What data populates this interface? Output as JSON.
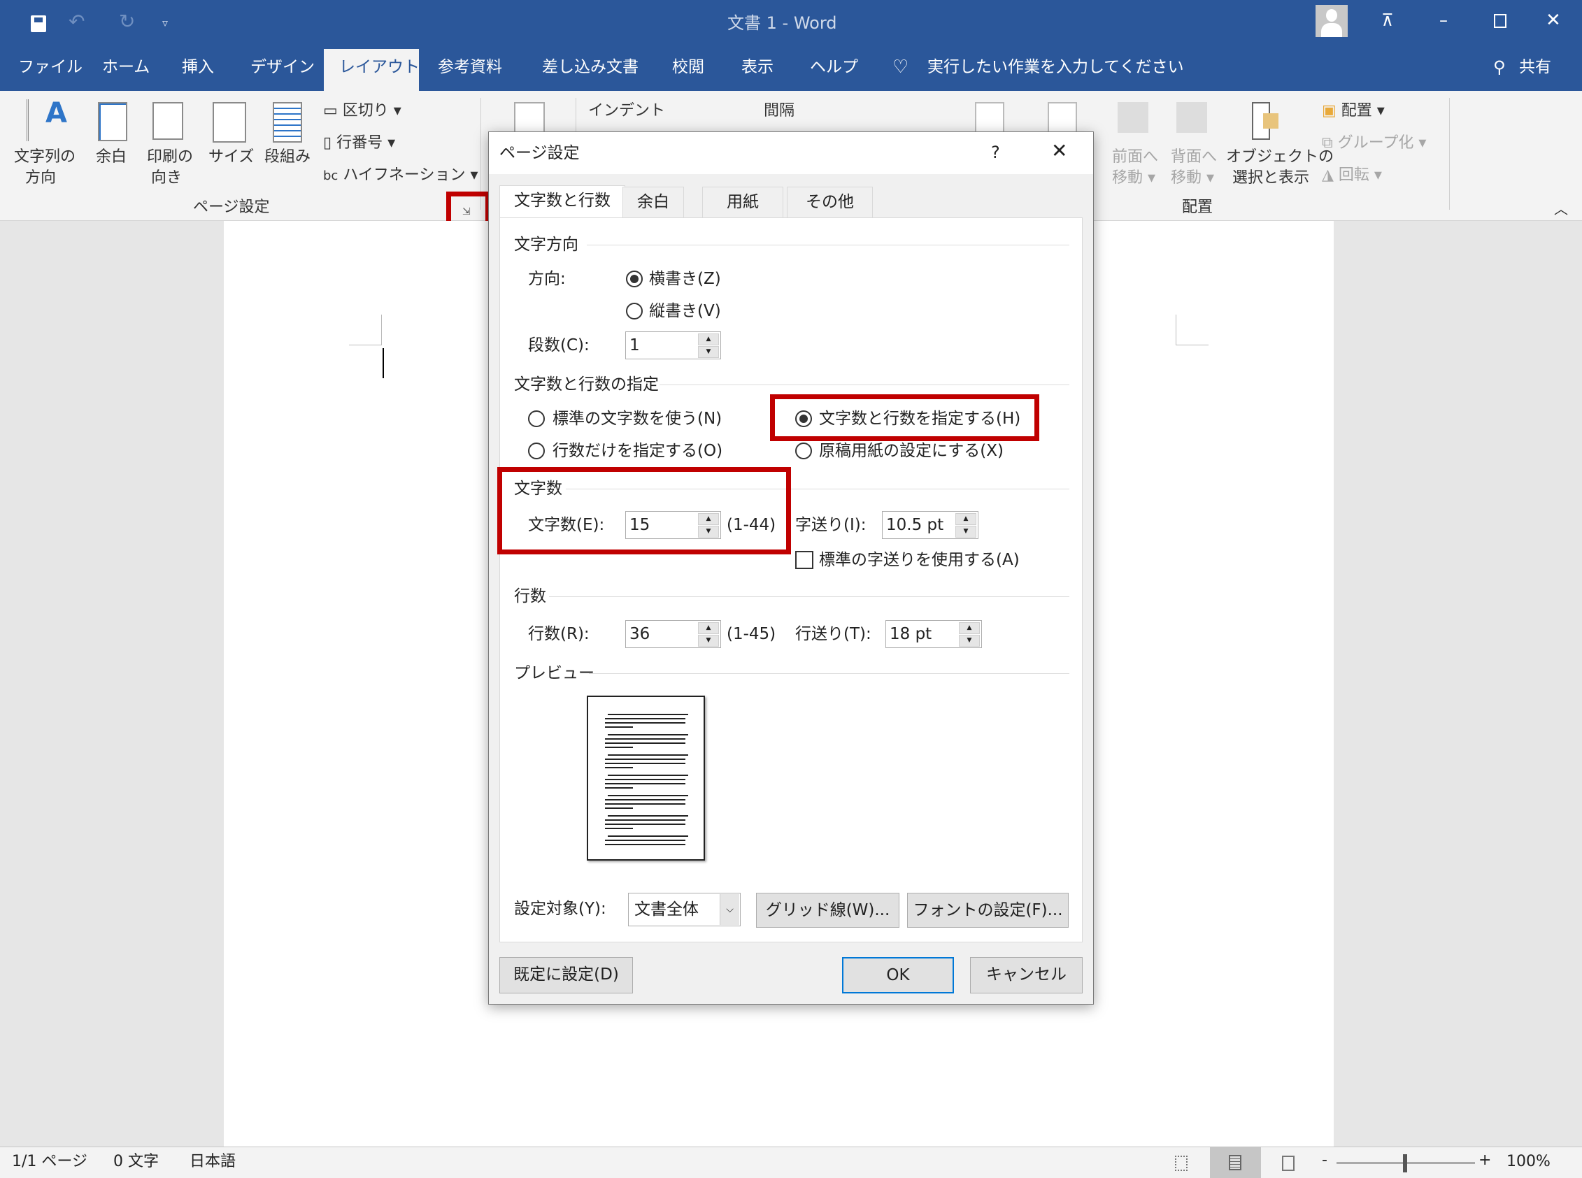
{
  "titlebar": {
    "title": "文書 1  -  Word",
    "save_icon": "save-icon",
    "undo_icon": "undo-icon",
    "redo_icon": "redo-icon",
    "customize_icon": "customize-qat-icon"
  },
  "tabs": [
    {
      "label": "ファイル"
    },
    {
      "label": "ホーム"
    },
    {
      "label": "挿入"
    },
    {
      "label": "デザイン"
    },
    {
      "label": "レイアウト",
      "active": true
    },
    {
      "label": "参考資料"
    },
    {
      "label": "差し込み文書"
    },
    {
      "label": "校閲"
    },
    {
      "label": "表示"
    },
    {
      "label": "ヘルプ"
    }
  ],
  "tell_me": "実行したい作業を入力してください",
  "share": "共有",
  "ribbon": {
    "page_setup": {
      "text_direction": [
        "文字列の",
        "方向"
      ],
      "margins": "余白",
      "orientation": [
        "印刷の",
        "向き"
      ],
      "size": "サイズ",
      "columns": "段組み",
      "breaks": "区切り",
      "line_numbers": "行番号",
      "hyphenation": "ハイフネーション",
      "group_label": "ページ設定"
    },
    "paragraph": {
      "indent": "インデント",
      "spacing": "間隔"
    },
    "arrange": {
      "bring_forward": [
        "前面へ",
        "移動"
      ],
      "send_backward": [
        "背面へ",
        "移動"
      ],
      "selection_pane": [
        "オブジェクトの",
        "選択と表示"
      ],
      "align": "配置",
      "group": "グループ化",
      "rotate": "回転",
      "group_label": "配置"
    }
  },
  "dialog": {
    "title": "ページ設定",
    "help": "?",
    "tabs": [
      "文字数と行数",
      "余白",
      "用紙",
      "その他"
    ],
    "direction_section": "文字方向",
    "direction_label": "方向:",
    "horizontal": "横書き(Z)",
    "vertical": "縦書き(V)",
    "direction_selected": "horizontal",
    "columns_label": "段数(C):",
    "columns_value": "1",
    "grid_section": "文字数と行数の指定",
    "opt_standard": "標準の文字数を使う(N)",
    "opt_lines_only": "行数だけを指定する(O)",
    "opt_chars_lines": "文字数と行数を指定する(H)",
    "opt_manuscript": "原稿用紙の設定にする(X)",
    "grid_selected": "chars_lines",
    "chars_section": "文字数",
    "chars_label": "文字数(E):",
    "chars_value": "15",
    "chars_range": "(1-44)",
    "char_pitch_label": "字送り(I):",
    "char_pitch_value": "10.5 pt",
    "use_default_pitch": "標準の字送りを使用する(A)",
    "use_default_pitch_checked": false,
    "lines_section": "行数",
    "lines_label": "行数(R):",
    "lines_value": "36",
    "lines_range": "(1-45)",
    "line_pitch_label": "行送り(T):",
    "line_pitch_value": "18 pt",
    "preview_section": "プレビュー",
    "apply_to_label": "設定対象(Y):",
    "apply_to_value": "文書全体",
    "grid_button": "グリッド線(W)...",
    "font_button": "フォントの設定(F)...",
    "default_button": "既定に設定(D)",
    "ok": "OK",
    "cancel": "キャンセル"
  },
  "status": {
    "page": "1/1 ページ",
    "words": "0 文字",
    "language": "日本語",
    "zoom": "100%",
    "zoom_level_percent": 100
  },
  "colors": {
    "accent": "#2b579a",
    "highlight": "#c00000",
    "ok_border": "#0078d7"
  }
}
